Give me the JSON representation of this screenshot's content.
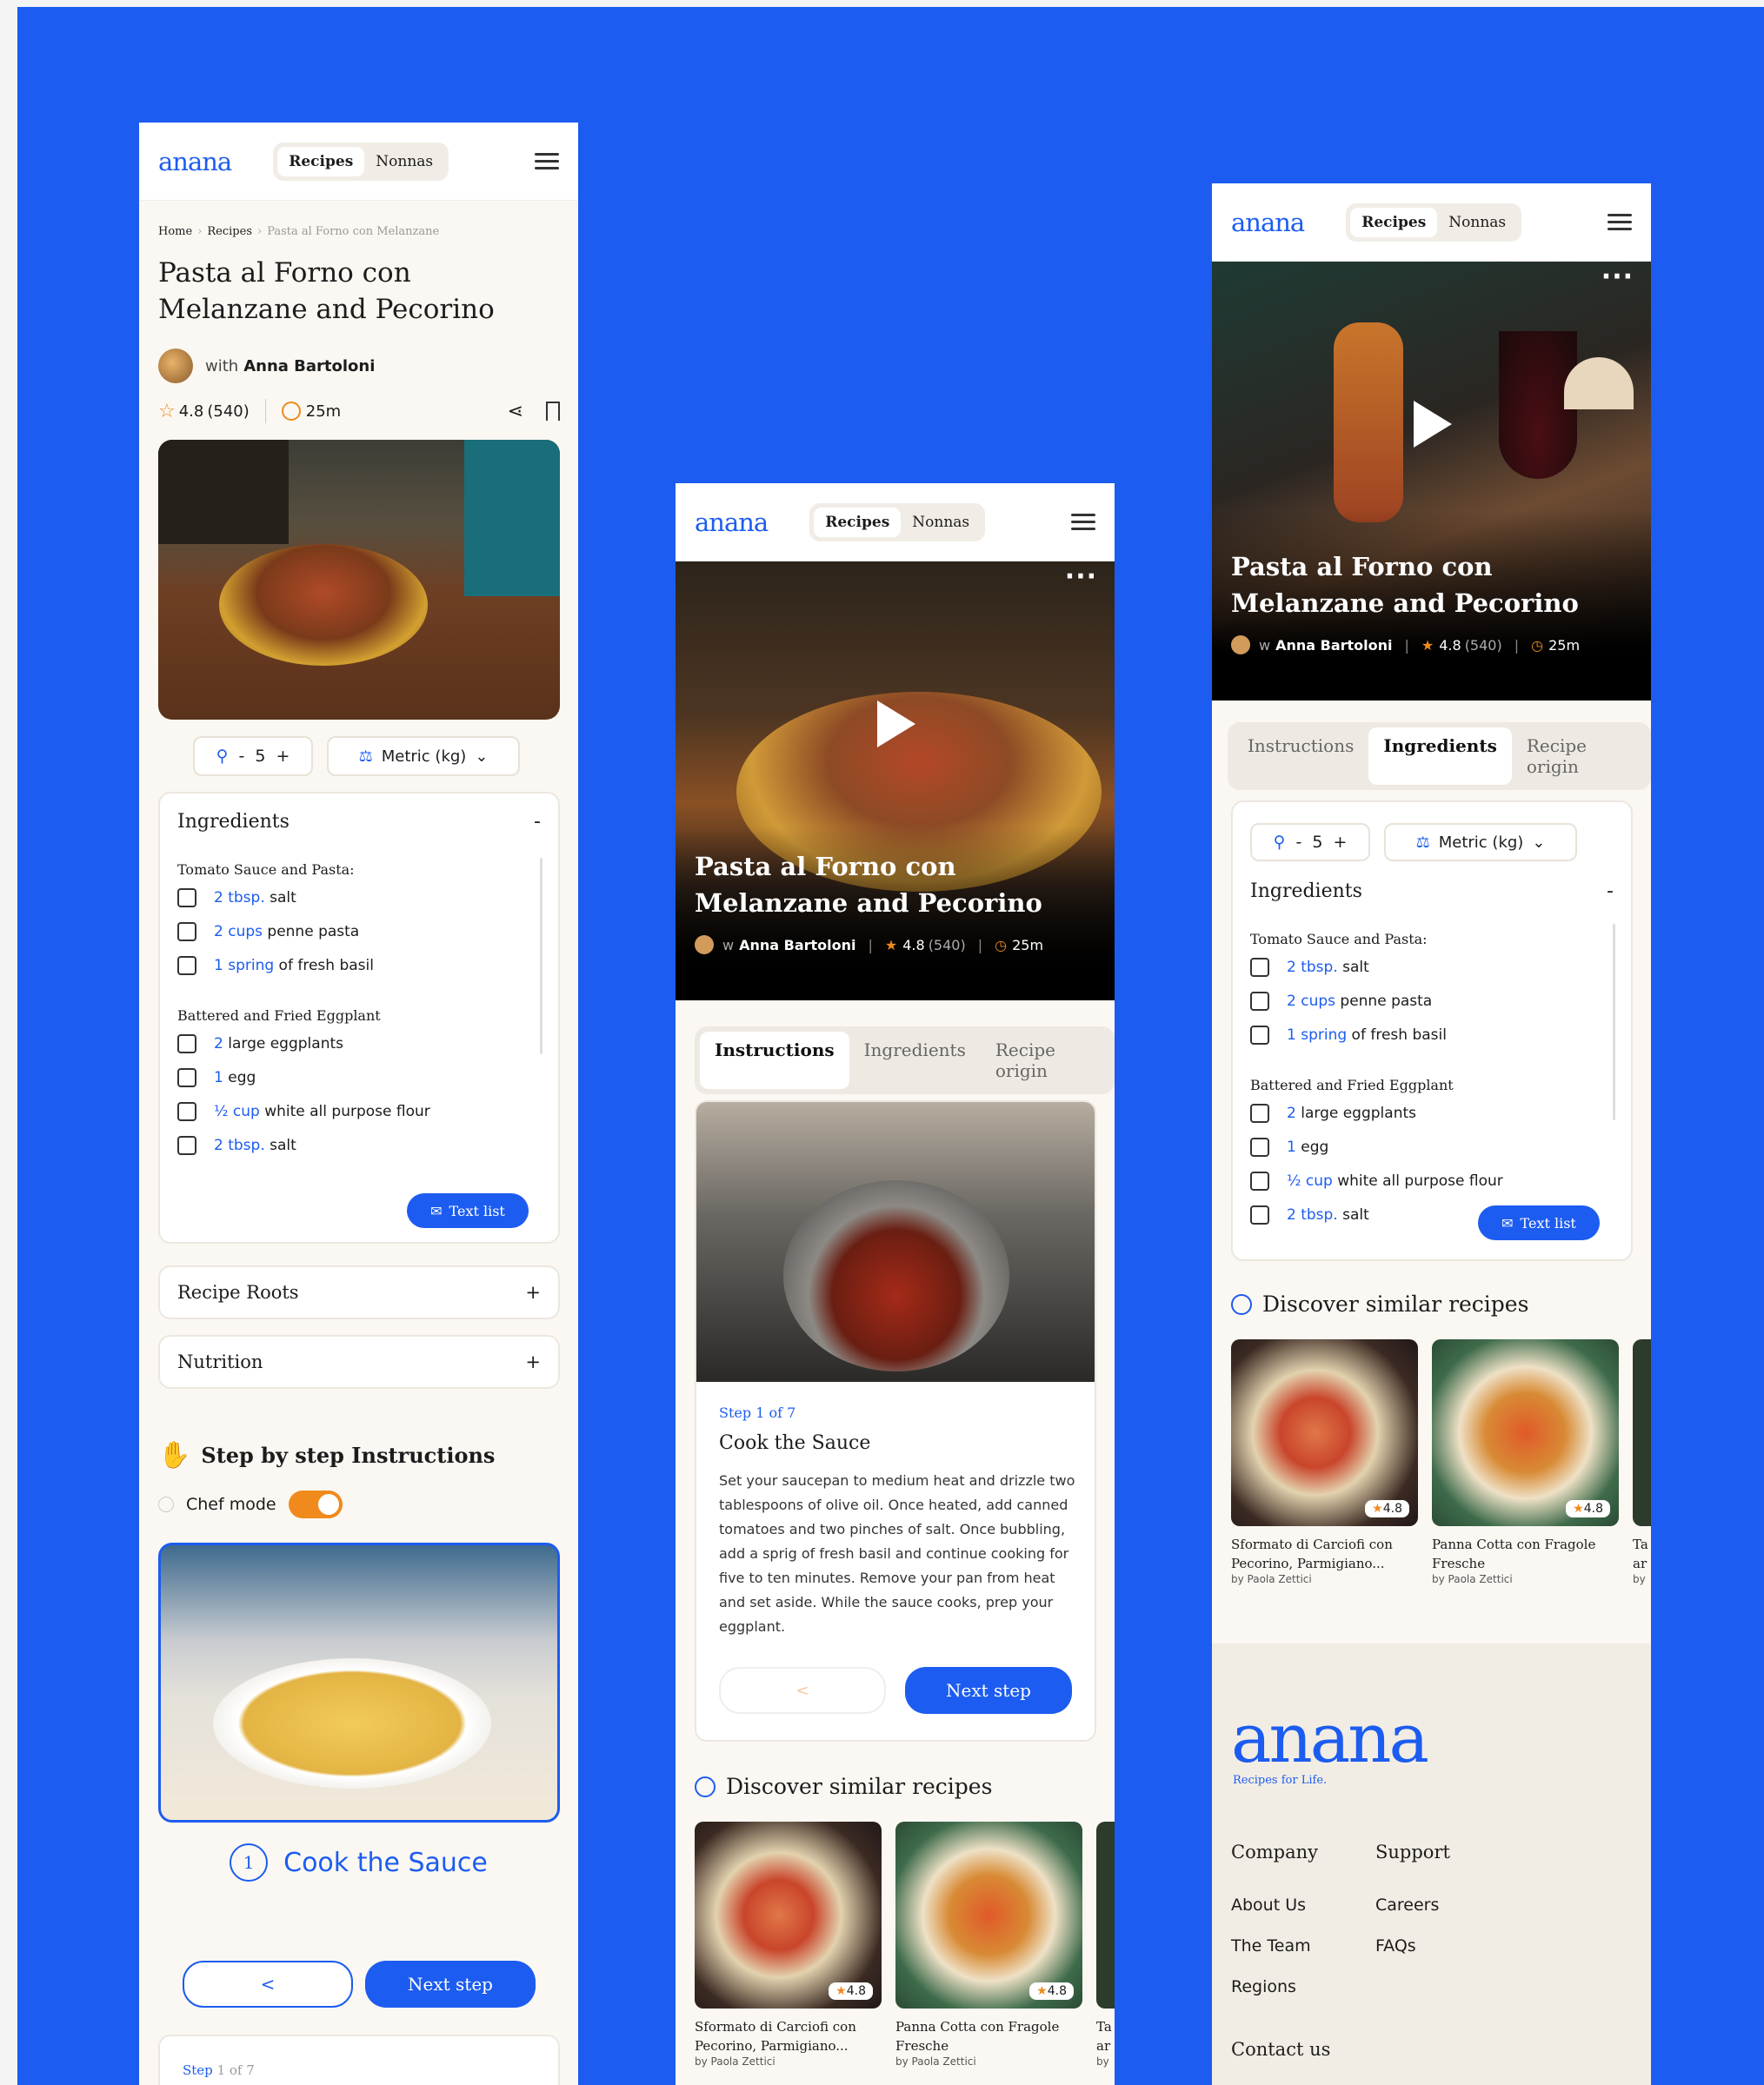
{
  "nav": {
    "logo": "anana",
    "tab_recipes": "Recipes",
    "tab_nonnas": "Nonnas"
  },
  "breadcrumb": {
    "home": "Home",
    "sep": "›",
    "recipes": "Recipes",
    "current": "Pasta al Forno con Melanzane"
  },
  "recipe": {
    "title": "Pasta al Forno con Melanzane and Pecorino",
    "with": "with",
    "author": "Anna Bartoloni",
    "w_prefix": "w",
    "rating": "4.8",
    "reviews": "(540)",
    "time": "25m"
  },
  "servings": {
    "minus": "-",
    "count": "5",
    "plus": "+",
    "units": "Metric (kg)"
  },
  "ingredients": {
    "heading": "Ingredients",
    "collapse": "-",
    "group1": "Tomato Sauce and Pasta:",
    "items1": [
      {
        "qty": "2 tbsp.",
        "name": " salt"
      },
      {
        "qty": "2 cups",
        "name": " penne pasta"
      },
      {
        "qty": "1 spring",
        "name": " of fresh basil"
      }
    ],
    "group2": "Battered and Fried Eggplant",
    "items2": [
      {
        "qty": "2",
        "name": " large eggplants"
      },
      {
        "qty": "1",
        "name": " egg"
      },
      {
        "qty": "½ cup",
        "name": " white all purpose flour"
      },
      {
        "qty": "2 tbsp.",
        "name": " salt"
      }
    ],
    "text_list": "Text list"
  },
  "accordions": {
    "roots": "Recipe Roots",
    "nutrition": "Nutrition",
    "plus": "+"
  },
  "instructions": {
    "heading": "Step by step Instructions",
    "chef_mode": "Chef mode",
    "step_num": "1",
    "step_title": "Cook the Sauce",
    "prev": "<",
    "next": "Next step",
    "step_label": "Step",
    "step_of": "1 of 7",
    "step_full": "Step 1 of 7",
    "body": "Set your saucepan to medium heat and drizzle two tablespoons of olive oil. Once heated, add canned tomatoes and two pinches of salt. Once bubbling, add a sprig of fresh basil and continue cooking for five to ten minutes. Remove your pan from heat and set aside. While the sauce cooks, prep your eggplant."
  },
  "tabs": {
    "instructions": "Instructions",
    "ingredients": "Ingredients",
    "origin": "Recipe origin"
  },
  "similar": {
    "heading": "Discover similar recipes",
    "cards": [
      {
        "title": "Sformato di Carciofi con Pecorino, Parmigiano...",
        "by": "by Paola Zettici",
        "rating": "4.8"
      },
      {
        "title": "Panna Cotta con Fragole Fresche",
        "by": "by Paola Zettici",
        "rating": "4.8"
      },
      {
        "title": "Ta ar",
        "by": "by"
      }
    ]
  },
  "footer": {
    "logo": "anana",
    "tagline": "Recipes for Life.",
    "company": "Company",
    "support": "Support",
    "about": "About Us",
    "careers": "Careers",
    "team": "The Team",
    "faqs": "FAQs",
    "regions": "Regions",
    "contact": "Contact us"
  },
  "colors": {
    "accent": "#1c5cf0",
    "orange": "#f08a1c",
    "background": "#fbf8f3"
  }
}
